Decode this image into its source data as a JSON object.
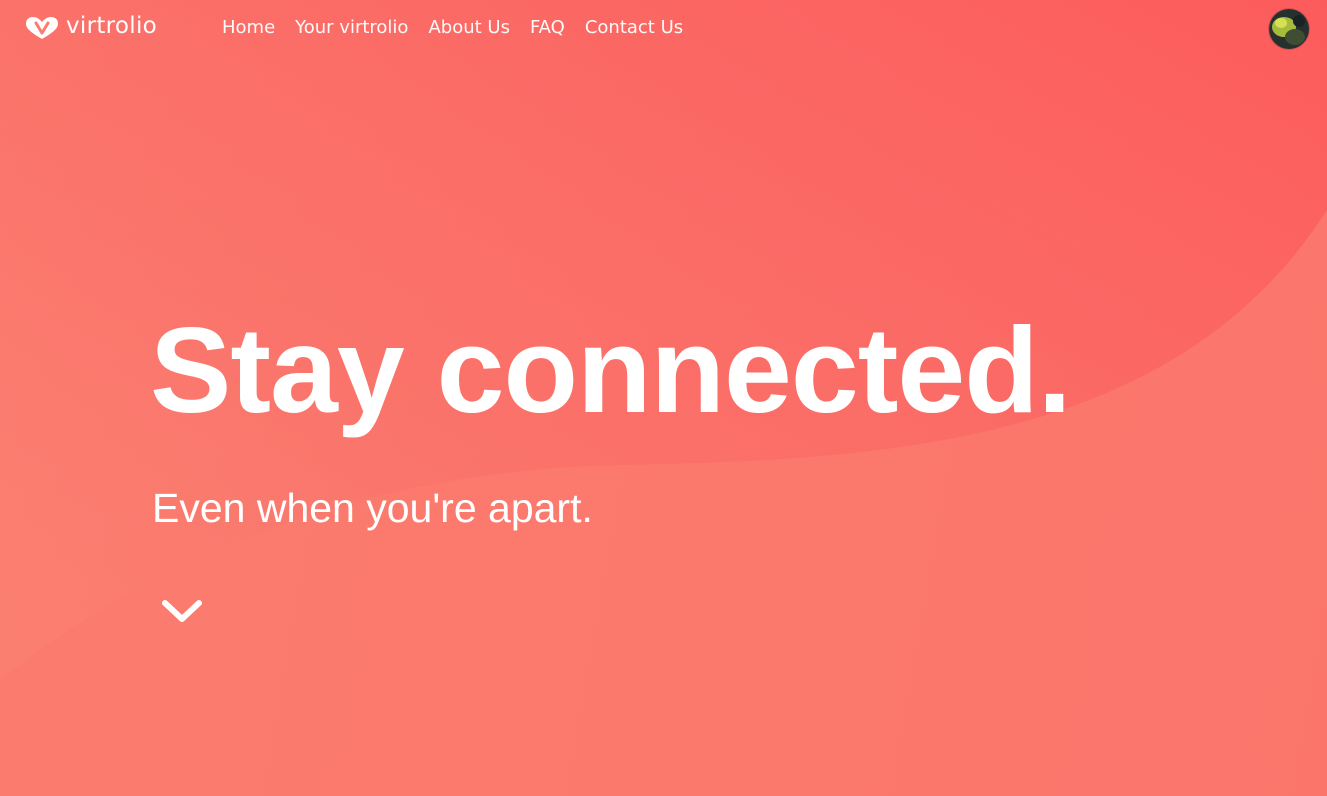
{
  "brand": {
    "name": "virtrolio",
    "logo_icon": "heart-v-logo-icon"
  },
  "nav": {
    "items": [
      {
        "label": "Home"
      },
      {
        "label": "Your virtrolio"
      },
      {
        "label": "About Us"
      },
      {
        "label": "FAQ"
      },
      {
        "label": "Contact Us"
      }
    ]
  },
  "user": {
    "avatar_icon": "user-avatar"
  },
  "hero": {
    "title": "Stay connected.",
    "subtitle": "Even when you're apart.",
    "scroll_icon": "chevron-down-icon"
  },
  "colors": {
    "background_start": "#fb8172",
    "background_end": "#fb7069",
    "wave": "#fc5f5c",
    "text": "#ffffff"
  }
}
